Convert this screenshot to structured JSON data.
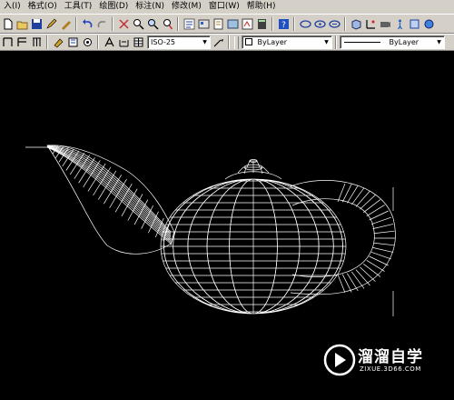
{
  "menus": [
    "入(I)",
    "格式(O)",
    "工具(T)",
    "绘图(D)",
    "标注(N)",
    "修改(M)",
    "窗口(W)",
    "帮助(H)"
  ],
  "dimstyle": {
    "value": "ISO-25"
  },
  "layer_color": {
    "value": "ByLayer"
  },
  "linetype": {
    "value": "ByLayer"
  },
  "watermark": {
    "brand": "溜溜自学",
    "url": "ZIXUE.3D66.COM"
  },
  "colors": {
    "chrome": "#d4d0c8",
    "canvas": "#000000",
    "wireframe": "#ffffff"
  }
}
